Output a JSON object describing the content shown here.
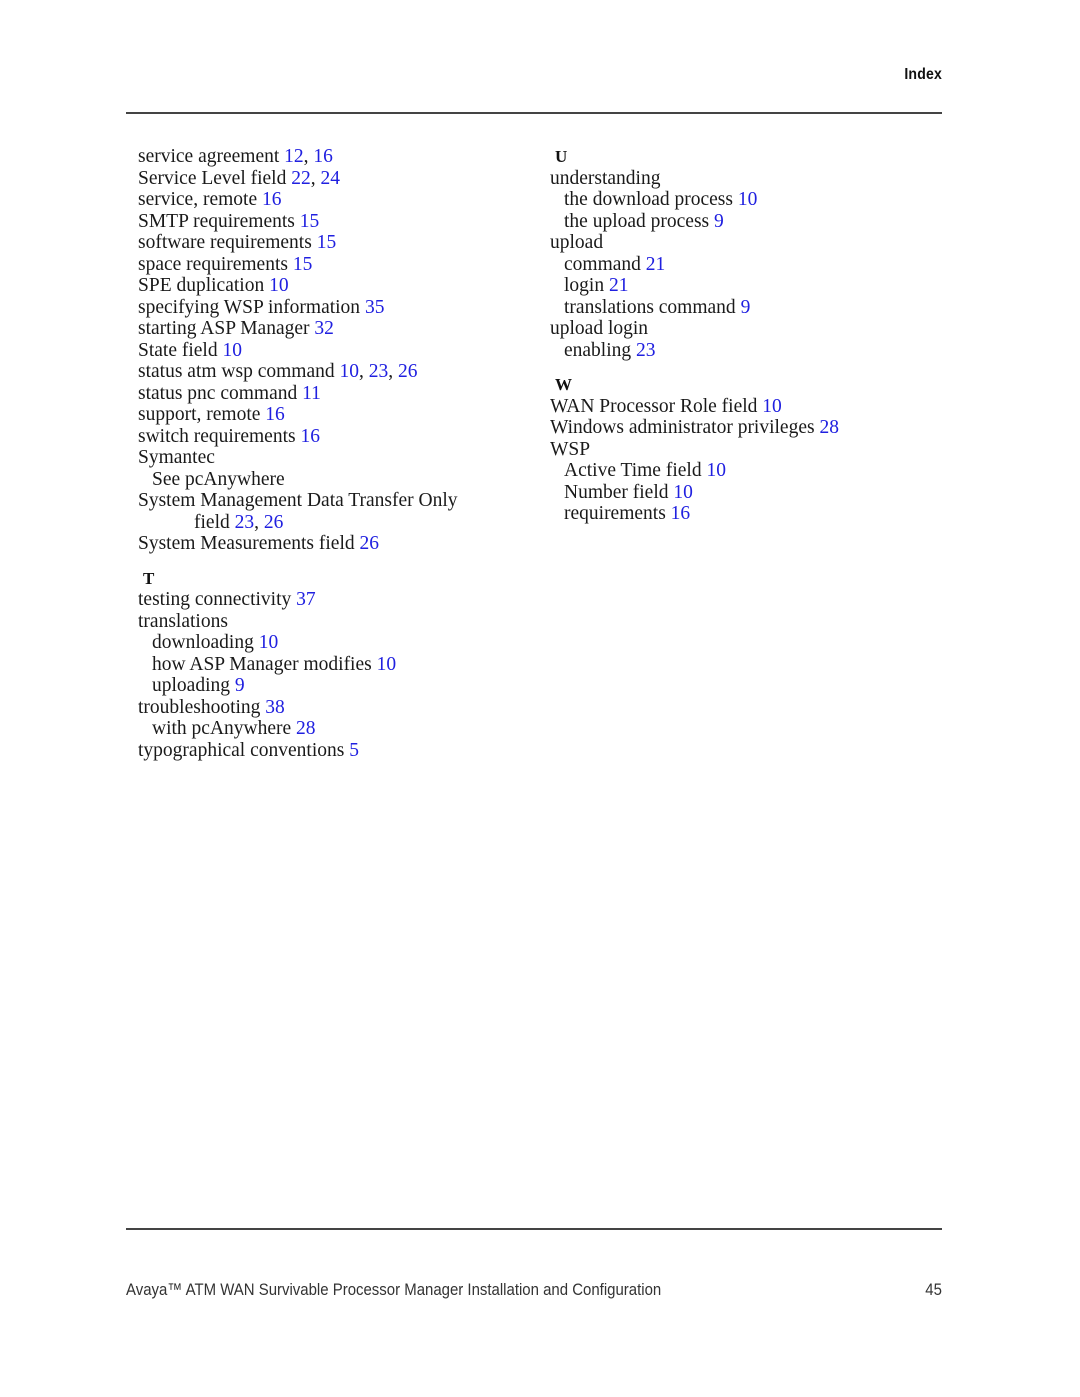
{
  "header": {
    "running_head": "Index"
  },
  "colors": {
    "page_number_link": "#2020e0",
    "text": "#1a1a1a",
    "rule": "#444444"
  },
  "index": {
    "columns": [
      {
        "name": "left-column",
        "sections": [
          {
            "letter": "",
            "entries": [
              {
                "term": "service agreement",
                "pages": "12, 16",
                "level": 0
              },
              {
                "term": "Service Level field",
                "pages": "22, 24",
                "level": 0
              },
              {
                "term": "service, remote",
                "pages": "16",
                "level": 0
              },
              {
                "term": "SMTP requirements",
                "pages": "15",
                "level": 0
              },
              {
                "term": "software requirements",
                "pages": "15",
                "level": 0
              },
              {
                "term": "space requirements",
                "pages": "15",
                "level": 0
              },
              {
                "term": "SPE duplication",
                "pages": "10",
                "level": 0
              },
              {
                "term": "specifying WSP information",
                "pages": "35",
                "level": 0
              },
              {
                "term": "starting ASP Manager",
                "pages": "32",
                "level": 0
              },
              {
                "term": "State field",
                "pages": "10",
                "level": 0
              },
              {
                "term": "status atm wsp command",
                "pages": "10, 23, 26",
                "level": 0
              },
              {
                "term": "status pnc command",
                "pages": "11",
                "level": 0
              },
              {
                "term": "support, remote",
                "pages": "16",
                "level": 0
              },
              {
                "term": "switch requirements",
                "pages": "16",
                "level": 0
              },
              {
                "term": "Symantec",
                "pages": "",
                "level": 0
              },
              {
                "term": "See pcAnywhere",
                "pages": "",
                "level": 1
              },
              {
                "term": "System Management Data Transfer Only",
                "pages": "",
                "level": 0
              },
              {
                "term": "field",
                "pages": "23, 26",
                "level": 4
              },
              {
                "term": "System Measurements field",
                "pages": "26",
                "level": 0
              }
            ]
          },
          {
            "letter": "T",
            "entries": [
              {
                "term": "testing connectivity",
                "pages": "37",
                "level": 0
              },
              {
                "term": "translations",
                "pages": "",
                "level": 0
              },
              {
                "term": "downloading",
                "pages": "10",
                "level": 1
              },
              {
                "term": "how ASP Manager modifies",
                "pages": "10",
                "level": 1
              },
              {
                "term": "uploading",
                "pages": "9",
                "level": 1
              },
              {
                "term": "troubleshooting",
                "pages": "38",
                "level": 0
              },
              {
                "term": "with pcAnywhere",
                "pages": "28",
                "level": 1
              },
              {
                "term": "typographical conventions",
                "pages": "5",
                "level": 0
              }
            ]
          }
        ]
      },
      {
        "name": "right-column",
        "sections": [
          {
            "letter": "U",
            "entries": [
              {
                "term": "understanding",
                "pages": "",
                "level": 0
              },
              {
                "term": "the download process",
                "pages": "10",
                "level": 1
              },
              {
                "term": "the upload process",
                "pages": "9",
                "level": 1
              },
              {
                "term": "upload",
                "pages": "",
                "level": 0
              },
              {
                "term": "command",
                "pages": "21",
                "level": 1
              },
              {
                "term": "login",
                "pages": "21",
                "level": 1
              },
              {
                "term": "translations command",
                "pages": "9",
                "level": 1
              },
              {
                "term": "upload login",
                "pages": "",
                "level": 0
              },
              {
                "term": "enabling",
                "pages": "23",
                "level": 1
              }
            ]
          },
          {
            "letter": "W",
            "entries": [
              {
                "term": "WAN Processor Role field",
                "pages": "10",
                "level": 0
              },
              {
                "term": "Windows administrator privileges",
                "pages": "28",
                "level": 0
              },
              {
                "term": "WSP",
                "pages": "",
                "level": 0
              },
              {
                "term": "Active Time field",
                "pages": "10",
                "level": 1
              },
              {
                "term": "Number field",
                "pages": "10",
                "level": 1
              },
              {
                "term": "requirements",
                "pages": "16",
                "level": 1
              }
            ]
          }
        ]
      }
    ]
  },
  "footer": {
    "document_title": "Avaya™ ATM WAN Survivable Processor Manager Installation and Configuration",
    "page_number": "45"
  }
}
